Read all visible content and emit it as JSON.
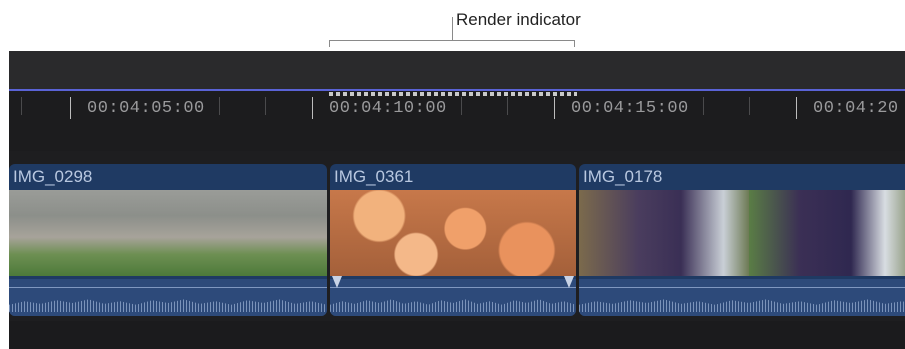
{
  "callout": {
    "label": "Render indicator"
  },
  "ruler": {
    "timecodes": [
      "00:04:05:00",
      "00:04:10:00",
      "00:04:15:00",
      "00:04:20"
    ]
  },
  "clips": [
    {
      "title": "IMG_0298"
    },
    {
      "title": "IMG_0361"
    },
    {
      "title": "IMG_0178"
    }
  ],
  "colors": {
    "timeline_bg": "#1e1e20",
    "clip_bg": "#1f3a63",
    "audio_bg": "#2d4a7a",
    "playhead": "#5a63d6"
  }
}
